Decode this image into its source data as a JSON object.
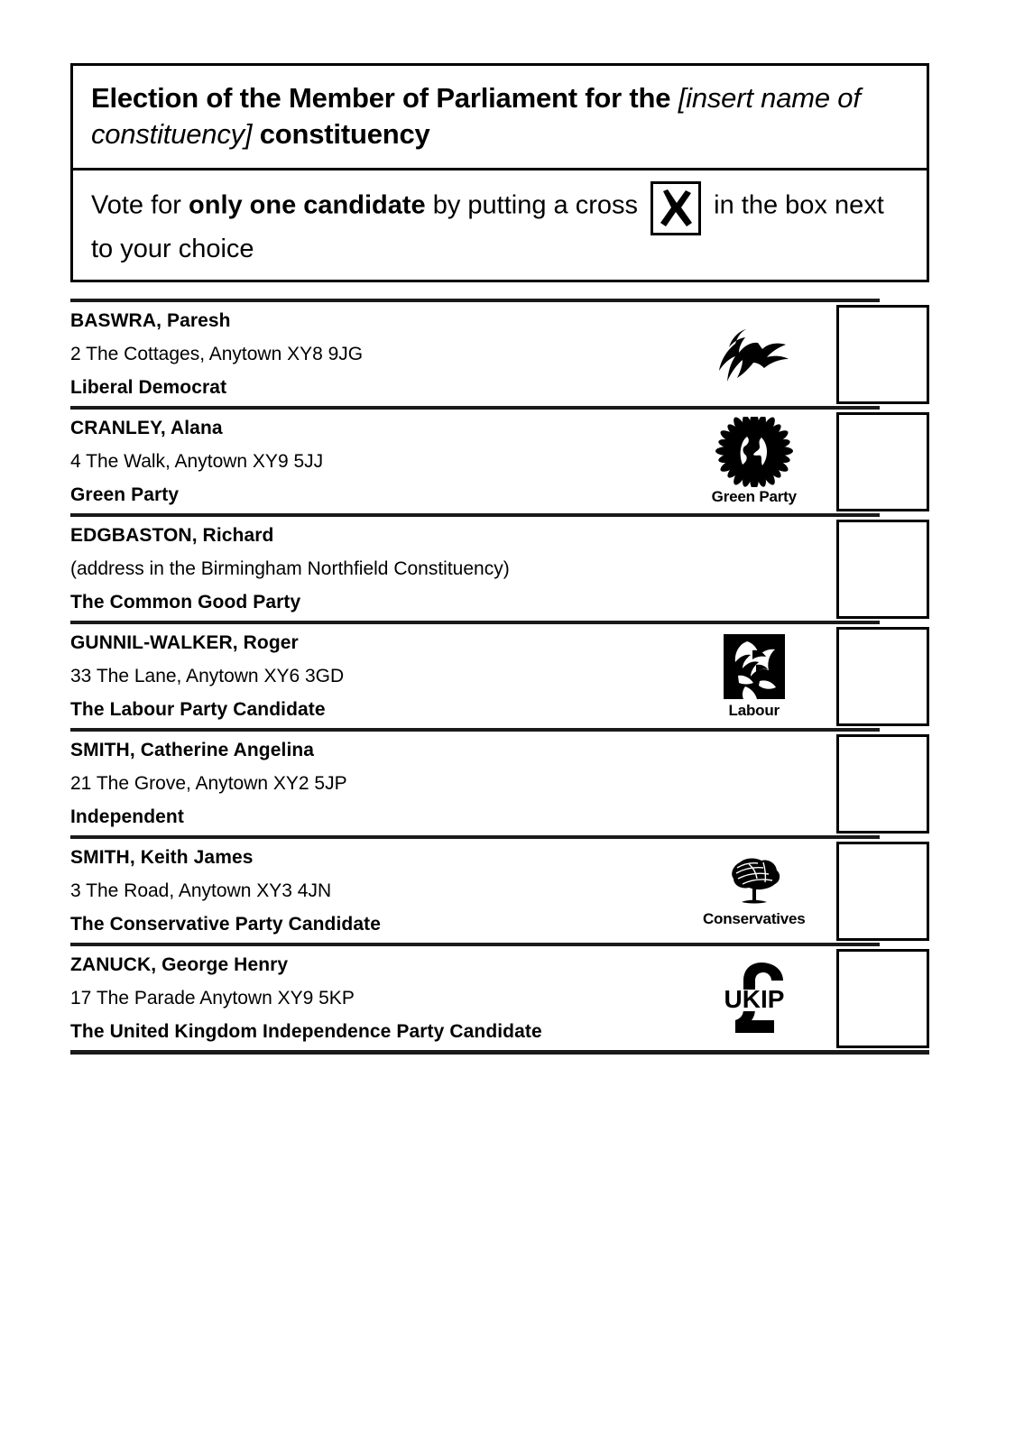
{
  "header": {
    "title_prefix": "Election of the Member of Parliament for the ",
    "title_placeholder": "[insert name of constituency]",
    "title_suffix": " constituency",
    "instruction_part1": "Vote for ",
    "instruction_emphasis": "only one candidate",
    "instruction_part2": " by putting a cross ",
    "instruction_part3": " in the box next to your choice",
    "cross_mark": "X"
  },
  "candidates": [
    {
      "name": "BASWRA, Paresh",
      "address": "2 The Cottages, Anytown XY8 9JG",
      "party": "Liberal Democrat",
      "logo": "libdem-bird-logo",
      "logo_caption": ""
    },
    {
      "name": "CRANLEY, Alana",
      "address": "4 The Walk, Anytown XY9 5JJ",
      "party": "Green Party",
      "logo": "green-party-sunflower-globe-logo",
      "logo_caption": "Green Party"
    },
    {
      "name": "EDGBASTON, Richard",
      "address": "(address in the Birmingham Northfield Constituency)",
      "party": "The Common Good Party",
      "logo": "",
      "logo_caption": ""
    },
    {
      "name": "GUNNIL-WALKER, Roger",
      "address": "33 The Lane, Anytown XY6 3GD",
      "party": "The Labour Party Candidate",
      "logo": "labour-rose-logo",
      "logo_caption": "Labour"
    },
    {
      "name": "SMITH, Catherine Angelina",
      "address": "21 The Grove, Anytown XY2 5JP",
      "party": "Independent",
      "logo": "",
      "logo_caption": ""
    },
    {
      "name": "SMITH, Keith James",
      "address": "3 The Road, Anytown XY3 4JN",
      "party": "The Conservative Party Candidate",
      "logo": "conservative-tree-logo",
      "logo_caption": "Conservatives"
    },
    {
      "name": "ZANUCK, George Henry",
      "address": "17 The Parade Anytown XY9 5KP",
      "party": "The United Kingdom Independence Party Candidate",
      "logo": "ukip-pound-logo",
      "logo_caption": "UKIP"
    }
  ],
  "colors": {
    "ink": "#000000",
    "rule": "#1a1a1a",
    "paper": "#ffffff"
  }
}
